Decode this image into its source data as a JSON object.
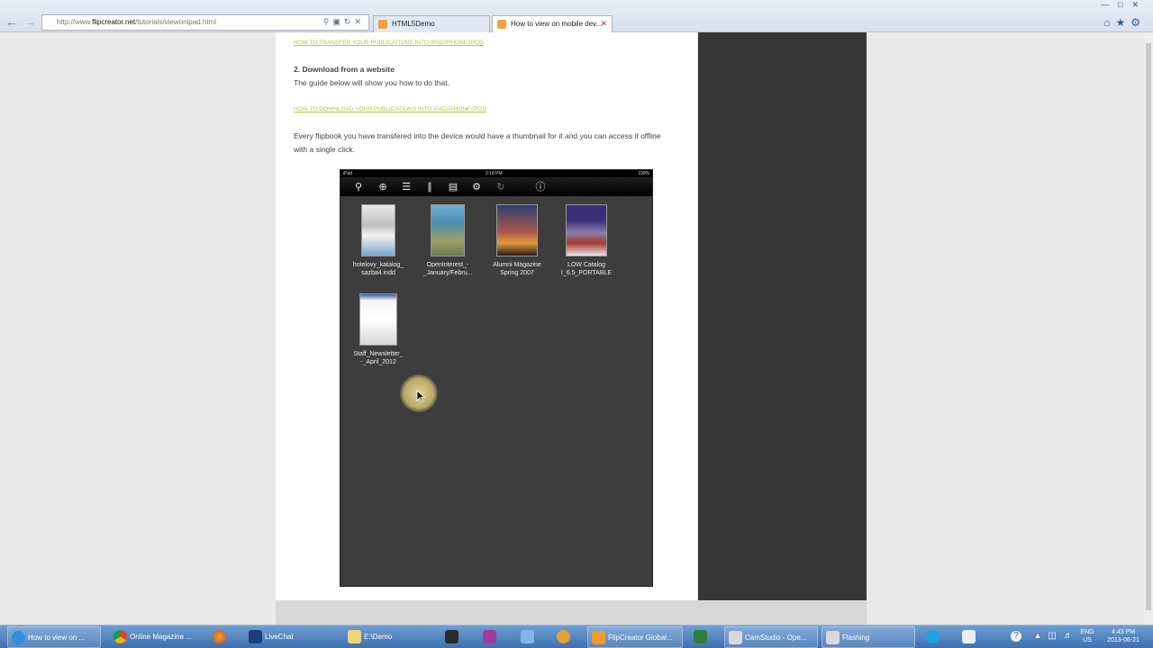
{
  "browser": {
    "address": "http://www.flipcreator.net/tutorials/viewonipad.html",
    "address_prefix": "http://www.",
    "address_host": "flipcreator.net",
    "address_path": "/tutorials/viewonipad.html",
    "tabs": [
      {
        "label": "HTML5Demo"
      },
      {
        "label": "How to view on mobile dev..."
      }
    ]
  },
  "content": {
    "link_transfer": "HOW TO TRANSFER YOUR PUBLICATIONS INTO IPAD/IPHONE/IPOD",
    "heading_download": "2. Download from a website",
    "guide_text": "The guide below will show you how to do that.",
    "link_download": "HOW TO DOWNLOAD YOUR PUBLICATIONS INTO IPAD/IPHONE/IPOD",
    "paragraph_line1": "Every flipbook you have transfered into the device would have a thumbnail for it and you can access it offline",
    "paragraph_line2": "with a single click."
  },
  "ipad": {
    "status_left": "iPad",
    "status_time": "2:18 PM",
    "status_battery": "100%",
    "books": [
      {
        "line1": "hotelovy_katalog_",
        "line2": "sazba4.indd"
      },
      {
        "line1": "OpenInterest_-",
        "line2": "_January/Febru..."
      },
      {
        "line1": "Alumni Magazine",
        "line2": "Spring 2007"
      },
      {
        "line1": "LOW Catalog",
        "line2": "I_6.5_PORTABLE"
      },
      {
        "line1": "Staff_Newsletter_",
        "line2": "-_April_2012"
      }
    ]
  },
  "taskbar": {
    "items": [
      {
        "label": "How to view on ..."
      },
      {
        "label": "Online Magazine ..."
      },
      {
        "label": "LiveChat"
      },
      {
        "label": "E:\\Demo"
      },
      {
        "label": "FlipCreator Global..."
      },
      {
        "label": "CamStudio - Ope..."
      },
      {
        "label": "Flashing"
      }
    ],
    "lang": "ENG",
    "region": "US",
    "time": "4:43 PM",
    "date": "2013-06-21"
  }
}
